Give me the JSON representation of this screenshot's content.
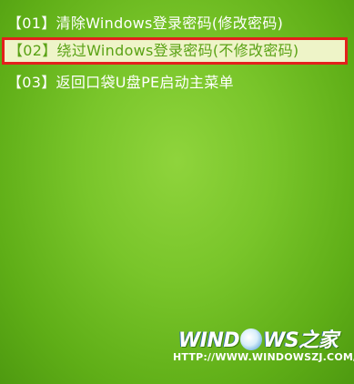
{
  "menu": {
    "items": [
      {
        "label": "【01】清除Windows登录密码(修改密码)"
      },
      {
        "label": "【02】绕过Windows登录密码(不修改密码)"
      },
      {
        "label": "【03】返回口袋U盘PE启动主菜单"
      }
    ]
  },
  "watermark": {
    "logo_left": "WIND",
    "logo_right": "WS之家",
    "url": "HTTP://WWW.WINDOWSZJ.COM/"
  }
}
